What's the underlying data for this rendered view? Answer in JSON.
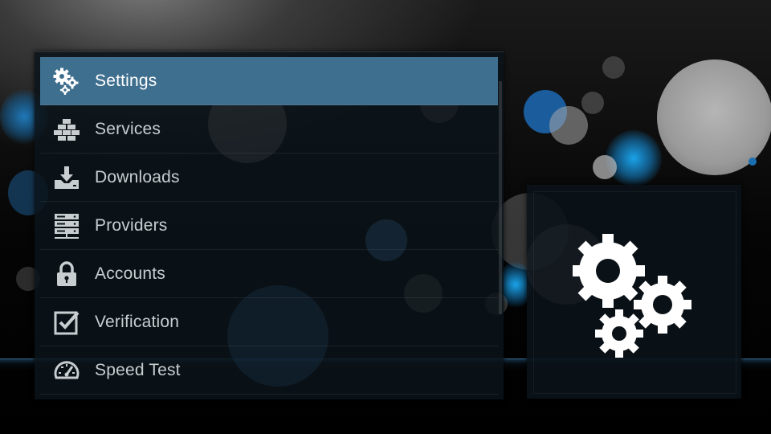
{
  "menu": {
    "items": [
      {
        "label": "Settings",
        "icon": "gears-icon",
        "selected": true
      },
      {
        "label": "Services",
        "icon": "bricks-icon",
        "selected": false
      },
      {
        "label": "Downloads",
        "icon": "download-tray-icon",
        "selected": false
      },
      {
        "label": "Providers",
        "icon": "server-icon",
        "selected": false
      },
      {
        "label": "Accounts",
        "icon": "lock-icon",
        "selected": false
      },
      {
        "label": "Verification",
        "icon": "checkbox-icon",
        "selected": false
      },
      {
        "label": "Speed Test",
        "icon": "speedometer-icon",
        "selected": false
      }
    ]
  },
  "preview": {
    "icon": "gears-icon"
  },
  "colors": {
    "selected": "#3f6f8e",
    "accent": "#1c8fd6"
  }
}
